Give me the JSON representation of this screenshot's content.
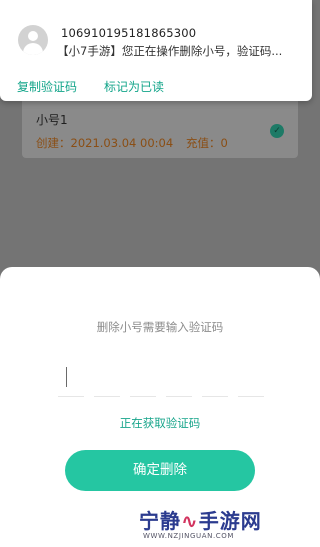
{
  "notification": {
    "sender": "106910195181865300",
    "message": "【小7手游】您正在操作删除小号，验证码...",
    "actions": {
      "copy_code": "复制验证码",
      "mark_read": "标记为已读"
    }
  },
  "background_account": {
    "name": "小号1",
    "created": "创建：2021.03.04 00:04",
    "recharge": "充值：0"
  },
  "dialog": {
    "prompt": "删除小号需要输入验证码",
    "code_value": "",
    "code_length": 6,
    "status": "正在获取验证码",
    "confirm_label": "确定删除"
  },
  "watermark": {
    "brand": "宁静手游网",
    "url": "WWW.NZJINGUAN.COM"
  },
  "colors": {
    "accent": "#25c6a2",
    "accent_text": "#13a58a",
    "dim_overlay": "#747474"
  }
}
